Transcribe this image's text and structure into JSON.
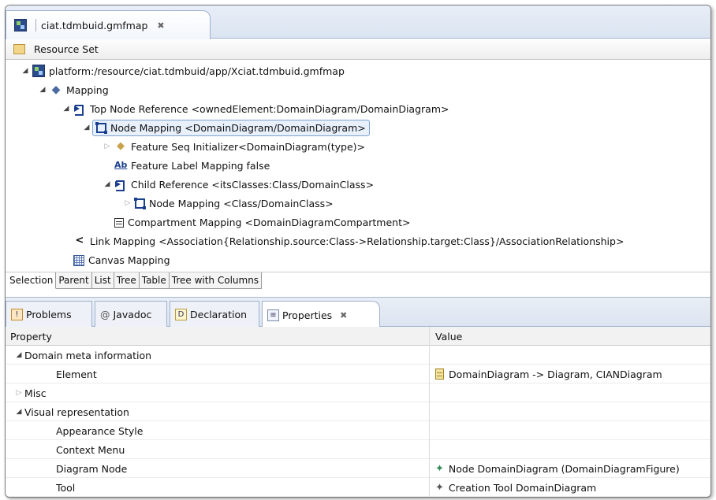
{
  "editor": {
    "tab_title": "ciat.tdmbuid.gmfmap",
    "close_symbol": "✖",
    "resource_bar_label": "Resource Set"
  },
  "tree": {
    "root": "platform:/resource/ciat.tdmbuid/app/Xciat.tdmbuid.gmfmap",
    "mapping": "Mapping",
    "top_node_ref": "Top Node Reference <ownedElement:DomainDiagram/DomainDiagram>",
    "node_mapping": "Node Mapping <DomainDiagram/DomainDiagram>",
    "feature_seq": "Feature Seq Initializer<DomainDiagram(type)>",
    "feature_label": "Feature Label Mapping false",
    "child_ref": "Child Reference <itsClasses:Class/DomainClass>",
    "child_node_mapping": "Node Mapping <Class/DomainClass>",
    "compartment": "Compartment Mapping <DomainDiagramCompartment>",
    "link_mapping": "Link Mapping <Association{Relationship.source:Class->Relationship.target:Class}/AssociationRelationship>",
    "canvas_mapping": "Canvas Mapping"
  },
  "editor_tabs": [
    "Selection",
    "Parent",
    "List",
    "Tree",
    "Table",
    "Tree with Columns"
  ],
  "views": {
    "problems": "Problems",
    "javadoc": "Javadoc",
    "declaration": "Declaration",
    "properties": "Properties"
  },
  "properties": {
    "header_property": "Property",
    "header_value": "Value",
    "rows": [
      {
        "label": "Domain meta information",
        "value": ""
      },
      {
        "label": "Element",
        "value": "DomainDiagram -> Diagram, CIANDiagram"
      },
      {
        "label": "Misc",
        "value": ""
      },
      {
        "label": "Visual representation",
        "value": ""
      },
      {
        "label": "Appearance Style",
        "value": ""
      },
      {
        "label": "Context Menu",
        "value": ""
      },
      {
        "label": "Diagram Node",
        "value": "Node DomainDiagram (DomainDiagramFigure)"
      },
      {
        "label": "Tool",
        "value": "Creation Tool DomainDiagram"
      }
    ]
  },
  "icons": {
    "map": "gmfmap-file-icon",
    "mapping": "mapping-icon",
    "accent_selected": "#7da2ce"
  }
}
